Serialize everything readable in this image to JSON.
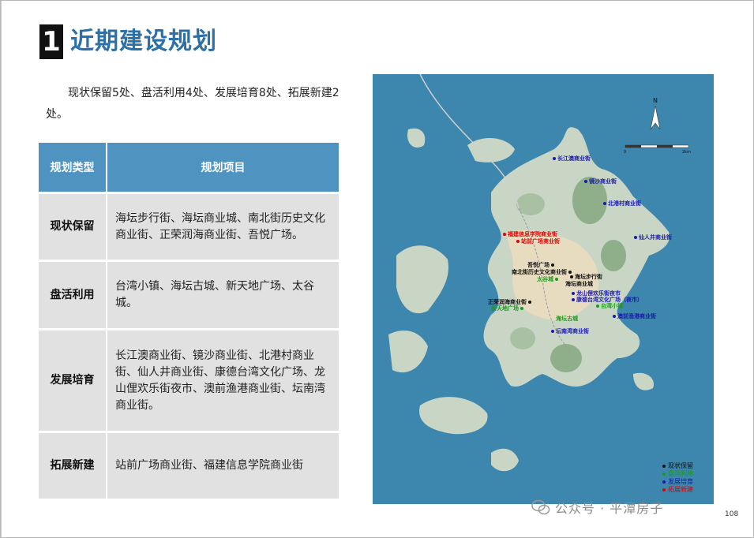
{
  "header": {
    "number": "1",
    "title": "近期建设规划"
  },
  "intro": "现状保留5处、盘活利用4处、发展培育8处、拓展新建2处。",
  "table": {
    "headers": [
      "规划类型",
      "规划项目"
    ],
    "rows": [
      {
        "type": "现状保留",
        "items": "海坛步行街、海坛商业城、南北街历史文化商业街、正荣润海商业街、吾悦广场。"
      },
      {
        "type": "盘活利用",
        "items": "台湾小镇、海坛古城、新天地广场、太谷城。"
      },
      {
        "type": "发展培育",
        "items": "长江澳商业街、镜沙商业街、北港村商业街、仙人井商业街、康德台湾文化广场、龙山俚欢乐街夜市、澳前渔港商业街、坛南湾商业街。"
      },
      {
        "type": "拓展新建",
        "items": "站前广场商业街、福建信息学院商业街"
      }
    ]
  },
  "map": {
    "colors": {
      "sea": "#3d86ad",
      "land": "#c9d6c6",
      "hill": "#8fae8a",
      "urban": "#e8dcc0"
    },
    "pois": [
      {
        "label": "长江澳商业街",
        "color": "#1a1aa8"
      },
      {
        "label": "镜沙商业街",
        "color": "#1a1aa8"
      },
      {
        "label": "北港村商业街",
        "color": "#1a1aa8"
      },
      {
        "label": "仙人井商业街",
        "color": "#1a1aa8"
      },
      {
        "label": "福建信息学院商业街",
        "color": "#e00000"
      },
      {
        "label": "站前广场商业街",
        "color": "#e00000"
      },
      {
        "label": "吾悦广场",
        "color": "#111111"
      },
      {
        "label": "南北街历史文化商业街",
        "color": "#111111"
      },
      {
        "label": "太谷城",
        "color": "#1a9a1a"
      },
      {
        "label": "海坛步行街",
        "color": "#111111"
      },
      {
        "label": "海坛商业城",
        "color": "#111111"
      },
      {
        "label": "龙山俚欢乐街夜市",
        "color": "#1a1aa8"
      },
      {
        "label": "康德台湾文化广场（夜市）",
        "color": "#1a1aa8"
      },
      {
        "label": "正荣润海商业街",
        "color": "#111111"
      },
      {
        "label": "新天地广场",
        "color": "#1a9a1a"
      },
      {
        "label": "台湾小镇",
        "color": "#1a9a1a"
      },
      {
        "label": "澳前渔港商业街",
        "color": "#1a1aa8"
      },
      {
        "label": "海坛古城",
        "color": "#1a9a1a"
      },
      {
        "label": "坛南湾商业街",
        "color": "#1a1aa8"
      }
    ],
    "legend": [
      {
        "label": "现状保留",
        "color": "#111111"
      },
      {
        "label": "盘活利用",
        "color": "#1a9a1a"
      },
      {
        "label": "发展培育",
        "color": "#1a1aa8"
      },
      {
        "label": "拓展新建",
        "color": "#e00000"
      }
    ],
    "north": "N",
    "scale_labels": [
      "0",
      "2km"
    ]
  },
  "watermark": "公众号 · 平潭房子",
  "page_number": "108"
}
